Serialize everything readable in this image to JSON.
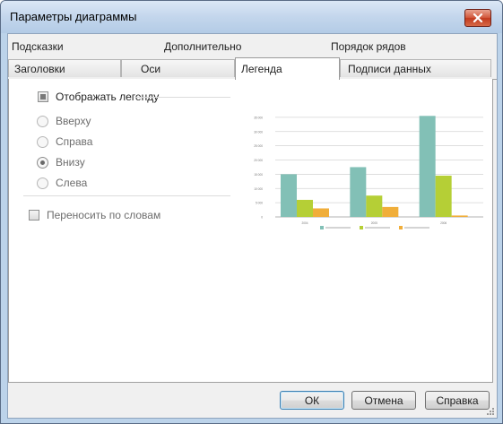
{
  "window": {
    "title": "Параметры диаграммы"
  },
  "tabs_row1": [
    "Подсказки",
    "Дополнительно",
    "Порядок рядов"
  ],
  "tabs_row2": [
    "Заголовки",
    "Оси",
    "Легенда",
    "Подписи данных"
  ],
  "legend_panel": {
    "show_legend": "Отображать легенду",
    "positions": [
      "Вверху",
      "Справа",
      "Внизу",
      "Слева"
    ],
    "selected_position": "Внизу",
    "word_wrap": "Переносить по словам"
  },
  "buttons": {
    "ok": "ОК",
    "cancel": "Отмена",
    "help": "Справка"
  },
  "colors": {
    "series1": "#82c0b6",
    "series2": "#b5cf36",
    "series3": "#f0ae3a"
  },
  "chart_data": {
    "type": "bar",
    "categories": [
      "2004",
      "2005",
      "2006"
    ],
    "series": [
      {
        "values": [
          15,
          17.5,
          35.5
        ]
      },
      {
        "values": [
          6,
          7.5,
          14.5
        ]
      },
      {
        "values": [
          3,
          3.5,
          0.5
        ]
      }
    ],
    "ylim": [
      0,
      40
    ],
    "yticks": [
      "0",
      "5 000",
      "10 000",
      "15 000",
      "20 000",
      "25 000",
      "30 000",
      "35 000"
    ],
    "legend": "bottom",
    "grid": true
  }
}
